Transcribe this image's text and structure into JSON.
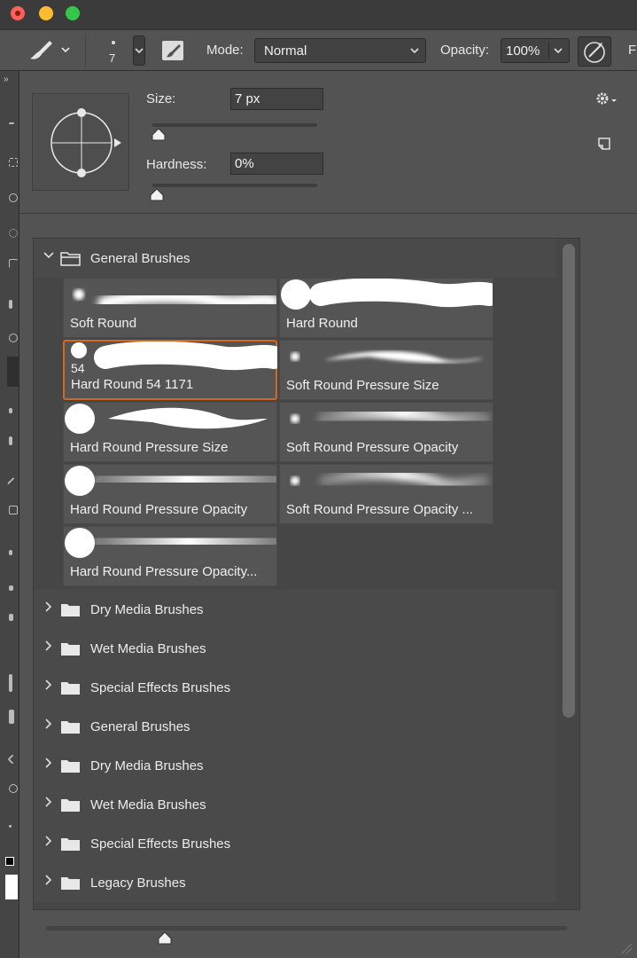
{
  "options_bar": {
    "brush_size_value": "7",
    "mode_label": "Mode:",
    "mode_value": "Normal",
    "opacity_label": "Opacity:",
    "opacity_value": "100%",
    "cut_label": "F"
  },
  "picker": {
    "size_label": "Size:",
    "size_value": "7 px",
    "size_level": 0.01,
    "hardness_label": "Hardness:",
    "hardness_value": "0%",
    "hardness_level": 0.0
  },
  "groups": [
    {
      "label": "General Brushes",
      "expanded": true
    },
    {
      "label": "Dry Media Brushes"
    },
    {
      "label": "Wet Media Brushes"
    },
    {
      "label": "Special Effects Brushes"
    },
    {
      "label": "General Brushes"
    },
    {
      "label": "Dry Media Brushes"
    },
    {
      "label": "Wet Media Brushes"
    },
    {
      "label": "Special Effects Brushes"
    },
    {
      "label": "Legacy Brushes"
    }
  ],
  "brushes": [
    {
      "name": "Soft Round",
      "tip": "soft",
      "stroke": "soft-even"
    },
    {
      "name": "Hard Round",
      "tip": "hard",
      "stroke": "hard-even"
    },
    {
      "name": "Hard Round 54 1171",
      "tip": "hard-small",
      "number": "54",
      "selected": true,
      "stroke": "hard-even"
    },
    {
      "name": "Soft Round Pressure Size",
      "tip": "soft-small",
      "stroke": "soft-taper"
    },
    {
      "name": "Hard Round Pressure Size",
      "tip": "hard",
      "stroke": "hard-taper"
    },
    {
      "name": "Soft Round Pressure Opacity",
      "tip": "soft-small",
      "stroke": "soft-fade"
    },
    {
      "name": "Hard Round Pressure Opacity",
      "tip": "hard",
      "stroke": "hard-fade"
    },
    {
      "name": "Soft Round Pressure Opacity ...",
      "tip": "soft-small",
      "stroke": "soft-fade-thin"
    },
    {
      "name": "Hard Round Pressure Opacity...",
      "tip": "hard",
      "stroke": "hard-fade"
    }
  ]
}
